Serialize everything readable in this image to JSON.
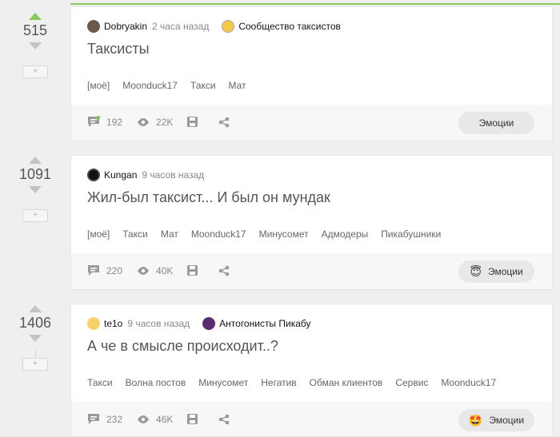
{
  "posts": [
    {
      "score": "515",
      "author": "Dobryakin",
      "time": "2 часа назад",
      "community": "Сообщество таксистов",
      "title": "Таксисты",
      "tags": [
        "[моё]",
        "Moonduck17",
        "Такси",
        "Мат"
      ],
      "comments": "192",
      "views": "22K",
      "emotions_label": "Эмоции",
      "plus": "+"
    },
    {
      "score": "1091",
      "author": "Kungan",
      "time": "9 часов назад",
      "title": "Жил-был таксист... И был он мундак",
      "tags": [
        "[моё]",
        "Такси",
        "Мат",
        "Moonduck17",
        "Минусомет",
        "Адмодеры",
        "Пикабушники"
      ],
      "comments": "220",
      "views": "40K",
      "emotions_label": "Эмоции",
      "emoji": "😇",
      "plus": "+"
    },
    {
      "score": "1406",
      "author": "te1o",
      "time": "9 часов назад",
      "community": "Антогонисты Пикабу",
      "title": "А че в смысле происходит..?",
      "tags": [
        "Такси",
        "Волна постов",
        "Минусомет",
        "Негатив",
        "Обман клиентов",
        "Сервис",
        "Moonduck17"
      ],
      "comments": "232",
      "views": "46K",
      "emotions_label": "Эмоции",
      "emoji": "🤩",
      "plus": "+"
    }
  ],
  "colors": {
    "accent": "#8ac858",
    "background": "#efefef"
  },
  "icons": [
    "arrow-up-icon",
    "arrow-down-icon",
    "comment-icon",
    "eye-icon",
    "save-icon",
    "share-icon"
  ]
}
